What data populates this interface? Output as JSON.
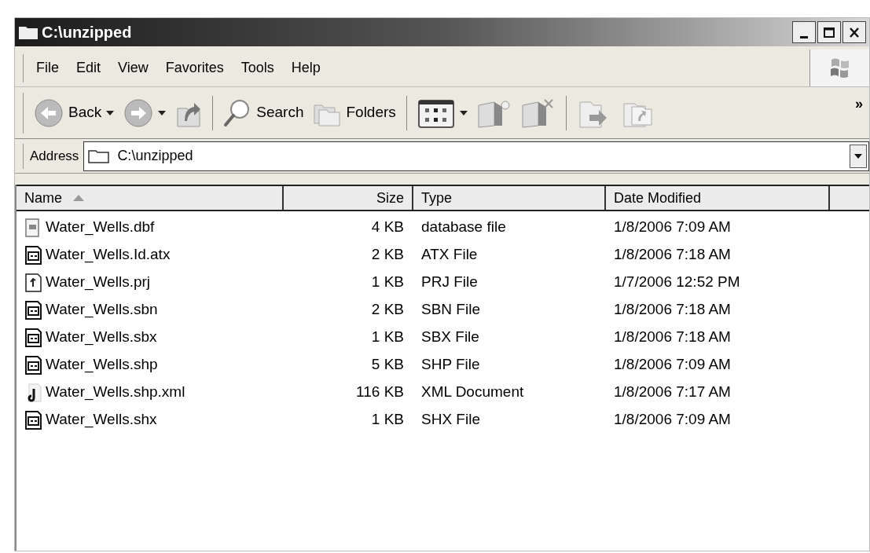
{
  "window": {
    "title": "C:\\unzipped"
  },
  "menu": [
    {
      "label": "File"
    },
    {
      "label": "Edit"
    },
    {
      "label": "View"
    },
    {
      "label": "Favorites"
    },
    {
      "label": "Tools"
    },
    {
      "label": "Help"
    }
  ],
  "toolbar": [
    {
      "kind": "back",
      "label": "Back"
    },
    {
      "kind": "forward"
    },
    {
      "kind": "up"
    },
    {
      "kind": "separator"
    },
    {
      "kind": "search",
      "label": "Search"
    },
    {
      "kind": "folders",
      "label": "Folders"
    },
    {
      "kind": "separator"
    },
    {
      "kind": "views"
    },
    {
      "kind": "new-folder"
    },
    {
      "kind": "delete-folder"
    },
    {
      "kind": "separator"
    },
    {
      "kind": "move"
    },
    {
      "kind": "copy"
    }
  ],
  "toolbar_more": "»",
  "address": {
    "label": "Address",
    "value": "C:\\unzipped"
  },
  "table": {
    "columns": [
      {
        "label": "Name",
        "sorted": true
      },
      {
        "label": "Size",
        "sorted": false
      },
      {
        "label": "Type",
        "sorted": false
      },
      {
        "label": "Date Modified",
        "sorted": false
      }
    ],
    "rows": [
      {
        "kind": "table",
        "name": "Water_Wells.dbf",
        "size": "4 KB",
        "type": "database file",
        "date": "1/8/2006 7:09 AM"
      },
      {
        "kind": "app",
        "name": "Water_Wells.Id.atx",
        "size": "2 KB",
        "type": "ATX File",
        "date": "1/8/2006 7:18 AM"
      },
      {
        "kind": "projection",
        "name": "Water_Wells.prj",
        "size": "1 KB",
        "type": "PRJ File",
        "date": "1/7/2006 12:52 PM"
      },
      {
        "kind": "app",
        "name": "Water_Wells.sbn",
        "size": "2 KB",
        "type": "SBN File",
        "date": "1/8/2006 7:18 AM"
      },
      {
        "kind": "app",
        "name": "Water_Wells.sbx",
        "size": "1 KB",
        "type": "SBX File",
        "date": "1/8/2006 7:18 AM"
      },
      {
        "kind": "app",
        "name": "Water_Wells.shp",
        "size": "5 KB",
        "type": "SHP File",
        "date": "1/8/2006 7:09 AM"
      },
      {
        "kind": "xml",
        "name": "Water_Wells.shp.xml",
        "size": "116 KB",
        "type": "XML Document",
        "date": "1/8/2006 7:17 AM"
      },
      {
        "kind": "app",
        "name": "Water_Wells.shx",
        "size": "1 KB",
        "type": "SHX File",
        "date": "1/8/2006 7:09 AM"
      }
    ]
  }
}
